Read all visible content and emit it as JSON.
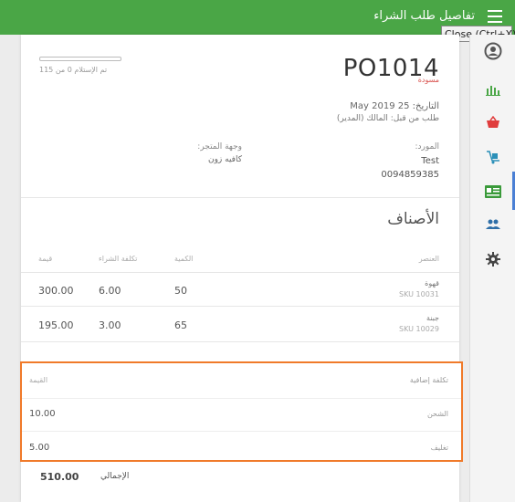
{
  "header": {
    "title": "تفاصيل طلب الشراء",
    "menu_icon": "hamburger-icon"
  },
  "tooltip": {
    "text": "Close (Ctrl+X)"
  },
  "sidebar": {
    "icons": [
      "user-circle-icon",
      "bar-chart-icon",
      "basket-icon",
      "cart-dolly-icon",
      "id-card-icon",
      "people-icon",
      "gear-icon"
    ],
    "active_index": 3
  },
  "order": {
    "number": "PO1014",
    "status": "مسودة",
    "progress_label": "تم الإستلام 0 من 115",
    "received_fraction": 0,
    "date_line": "التاريخ: 25 May 2019",
    "requested_by_line": "طلب من قبل: المالك (المدير)",
    "supplier_label": "المورد:",
    "supplier_name": "Test",
    "supplier_phone": "0094859385",
    "destination_label": "وجهة المتجر:",
    "destination_value": "كافيه زون"
  },
  "items": {
    "title": "الأصناف",
    "columns": {
      "element": "العنصر",
      "quantity": "الكمية",
      "purchase_cost": "تكلفة الشراء",
      "value": "قيمة"
    },
    "rows": [
      {
        "name": "قهوة",
        "sku": "SKU 10031",
        "quantity": "50",
        "cost": "6.00",
        "value": "300.00"
      },
      {
        "name": "جبنة",
        "sku": "SKU 10029",
        "quantity": "65",
        "cost": "3.00",
        "value": "195.00"
      }
    ]
  },
  "additional_costs": {
    "header_label": "تكلفة إضافية",
    "header_value": "القيمة",
    "rows": [
      {
        "label": "الشحن",
        "value": "10.00"
      },
      {
        "label": "تغليف",
        "value": "5.00"
      }
    ]
  },
  "total": {
    "label": "الإجمالي",
    "value": "510.00"
  },
  "colors": {
    "header_green": "#4aa646",
    "highlight_orange": "#f07a2a",
    "status_red": "#d9534f",
    "sidebar_icon": "#4aa646"
  }
}
